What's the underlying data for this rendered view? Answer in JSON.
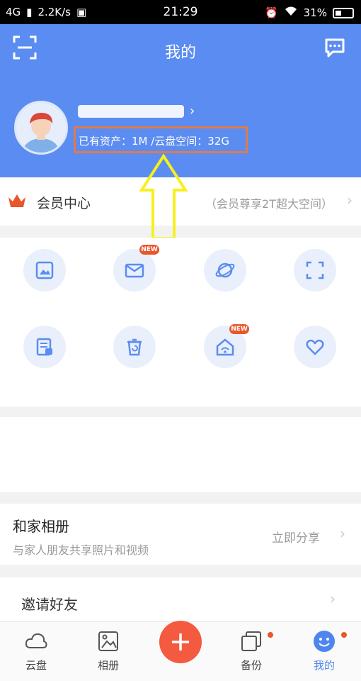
{
  "status_bar": {
    "network": "4G",
    "speed": "2.2K/s",
    "time": "21:29",
    "battery": "31%"
  },
  "header": {
    "title": "我的",
    "assets_text": "已有资产：1M /云盘空间：32G"
  },
  "member": {
    "title": "会员中心",
    "subtitle": "（会员尊享2T超大空间）"
  },
  "tools": {
    "badges": [
      "NEW",
      "NEW"
    ]
  },
  "album": {
    "title": "和家相册",
    "subtitle": "与家人朋友共享照片和视频",
    "action": "立即分享"
  },
  "invite": {
    "title": "邀请好友"
  },
  "bottom_nav": {
    "items": [
      {
        "label": "云盘"
      },
      {
        "label": "相册"
      },
      {
        "label": "备份"
      },
      {
        "label": "我的"
      }
    ]
  },
  "colors": {
    "primary": "#5b8cf1",
    "accent": "#f35a3f",
    "highlight_box": "#e07b4a",
    "arrow": "#f7f01c"
  }
}
